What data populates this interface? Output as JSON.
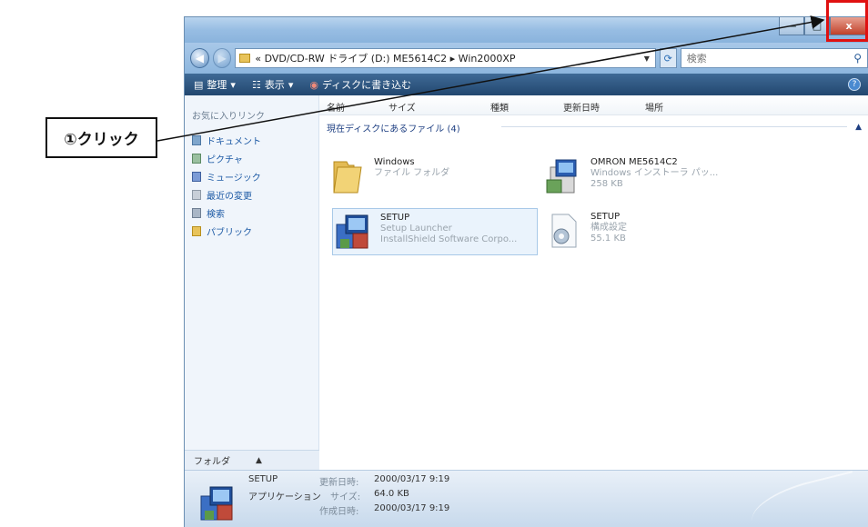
{
  "window": {
    "minimize": "—",
    "maximize": "□",
    "close": "x"
  },
  "address": {
    "path": "« DVD/CD-RW ドライブ (D:) ME5614C2 ▸ Win2000XP",
    "search_placeholder": "検索"
  },
  "toolbar": {
    "organize": "整理",
    "views": "表示",
    "burn": "ディスクに書き込む"
  },
  "sidebar": {
    "header": "お気に入りリンク",
    "items": [
      {
        "label": "ドキュメント",
        "icon": "document-icon"
      },
      {
        "label": "ピクチャ",
        "icon": "pictures-icon"
      },
      {
        "label": "ミュージック",
        "icon": "music-icon"
      },
      {
        "label": "最近の変更",
        "icon": "recent-icon"
      },
      {
        "label": "検索",
        "icon": "search-folder-icon"
      },
      {
        "label": "パブリック",
        "icon": "public-folder-icon"
      }
    ],
    "folders_label": "フォルダ"
  },
  "columns": [
    "名前",
    "サイズ",
    "種類",
    "更新日時",
    "場所"
  ],
  "group": {
    "title": "現在ディスクにあるファイル (4)"
  },
  "files": [
    {
      "name": "Windows",
      "line2": "ファイル フォルダ",
      "line3": ""
    },
    {
      "name": "OMRON ME5614C2",
      "line2": "Windows インストーラ パッ...",
      "line3": "258 KB"
    },
    {
      "name": "SETUP",
      "line2": "Setup Launcher",
      "line3": "InstallShield Software Corpo..."
    },
    {
      "name": "SETUP",
      "line2": "構成設定",
      "line3": "55.1 KB"
    }
  ],
  "details": {
    "name": "SETUP",
    "type": "アプリケーション",
    "modified_label": "更新日時:",
    "modified": "2000/03/17 9:19",
    "size_label": "サイズ:",
    "size": "64.0 KB",
    "created_label": "作成日時:",
    "created": "2000/03/17 9:19"
  },
  "annotation": {
    "label": "①クリック"
  }
}
